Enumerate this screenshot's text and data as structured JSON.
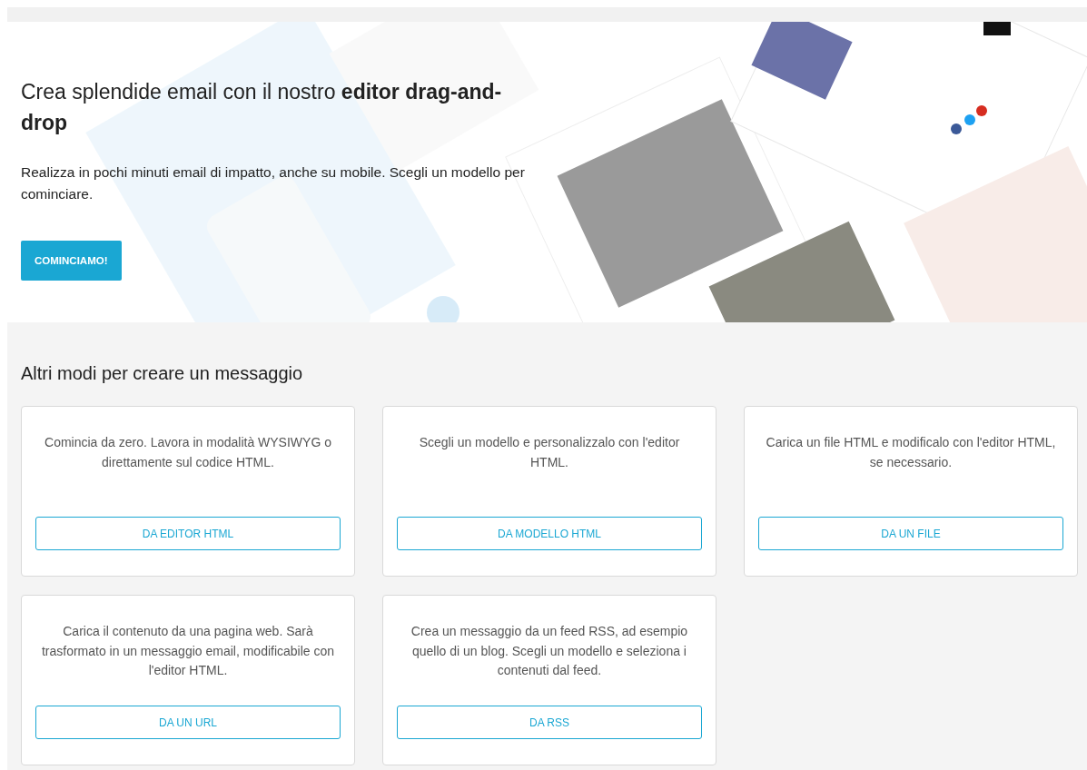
{
  "hero": {
    "title": "Crea splendide email con il nostro **editor drag-and-drop**",
    "subtitle": "Realizza in pochi minuti email di impatto, anche su mobile. Scegli un modello per cominciare.",
    "button": "COMINCIAMO!"
  },
  "section_title": "Altri modi per creare un messaggio",
  "cards": [
    {
      "description": "Comincia da zero. Lavora in modalità WYSIWYG o direttamente sul codice HTML.",
      "button": "DA EDITOR HTML"
    },
    {
      "description": "Scegli un modello e personalizzalo con l'editor HTML.",
      "button": "DA MODELLO HTML"
    },
    {
      "description": "Carica un file HTML e modificalo con l'editor HTML, se necessario.",
      "button": "DA UN FILE"
    },
    {
      "description": "Carica il contenuto da una pagina web. Sarà trasformato in un messaggio email, modificabile con l'editor HTML.",
      "button": "DA UN URL"
    },
    {
      "description": "Crea un messaggio da un feed RSS, ad esempio quello di un blog. Scegli un modello e seleziona i contenuti dal feed.",
      "button": "DA RSS"
    }
  ]
}
